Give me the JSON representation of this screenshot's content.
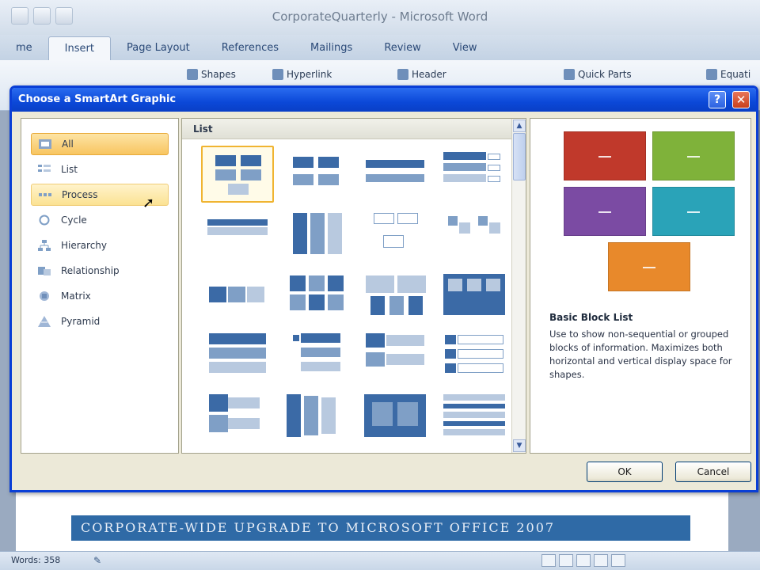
{
  "word": {
    "title": "CorporateQuarterly - Microsoft Word",
    "tabs": [
      {
        "label": "me",
        "active": false
      },
      {
        "label": "Insert",
        "active": true
      },
      {
        "label": "Page Layout",
        "active": false
      },
      {
        "label": "References",
        "active": false
      },
      {
        "label": "Mailings",
        "active": false
      },
      {
        "label": "Review",
        "active": false
      },
      {
        "label": "View",
        "active": false
      }
    ],
    "ribbon": {
      "shapes": "Shapes",
      "hyperlink": "Hyperlink",
      "header": "Header",
      "quick_parts": "Quick Parts",
      "equation": "Equati"
    },
    "banner": "CORPORATE-WIDE UPGRADE TO MICROSOFT OFFICE 2007",
    "status": {
      "words": "Words: 358"
    }
  },
  "dialog": {
    "title": "Choose a SmartArt Graphic",
    "help_label": "?",
    "close_label": "✕",
    "categories": [
      {
        "label": "All",
        "state": "selected",
        "icon": "all-icon"
      },
      {
        "label": "List",
        "state": "normal",
        "icon": "list-icon"
      },
      {
        "label": "Process",
        "state": "hover",
        "icon": "process-icon"
      },
      {
        "label": "Cycle",
        "state": "normal",
        "icon": "cycle-icon"
      },
      {
        "label": "Hierarchy",
        "state": "normal",
        "icon": "hierarchy-icon"
      },
      {
        "label": "Relationship",
        "state": "normal",
        "icon": "relationship-icon"
      },
      {
        "label": "Matrix",
        "state": "normal",
        "icon": "matrix-icon"
      },
      {
        "label": "Pyramid",
        "state": "normal",
        "icon": "pyramid-icon"
      }
    ],
    "gallery_heading": "List",
    "preview": {
      "name": "Basic Block List",
      "description": "Use to show non-sequential or grouped blocks of information. Maximizes both horizontal and vertical display space for shapes.",
      "colors": [
        "#c0392b",
        "#7fb23a",
        "#7b4ba3",
        "#2aa3b8",
        "#e8892b"
      ]
    },
    "ok_label": "OK",
    "cancel_label": "Cancel"
  }
}
